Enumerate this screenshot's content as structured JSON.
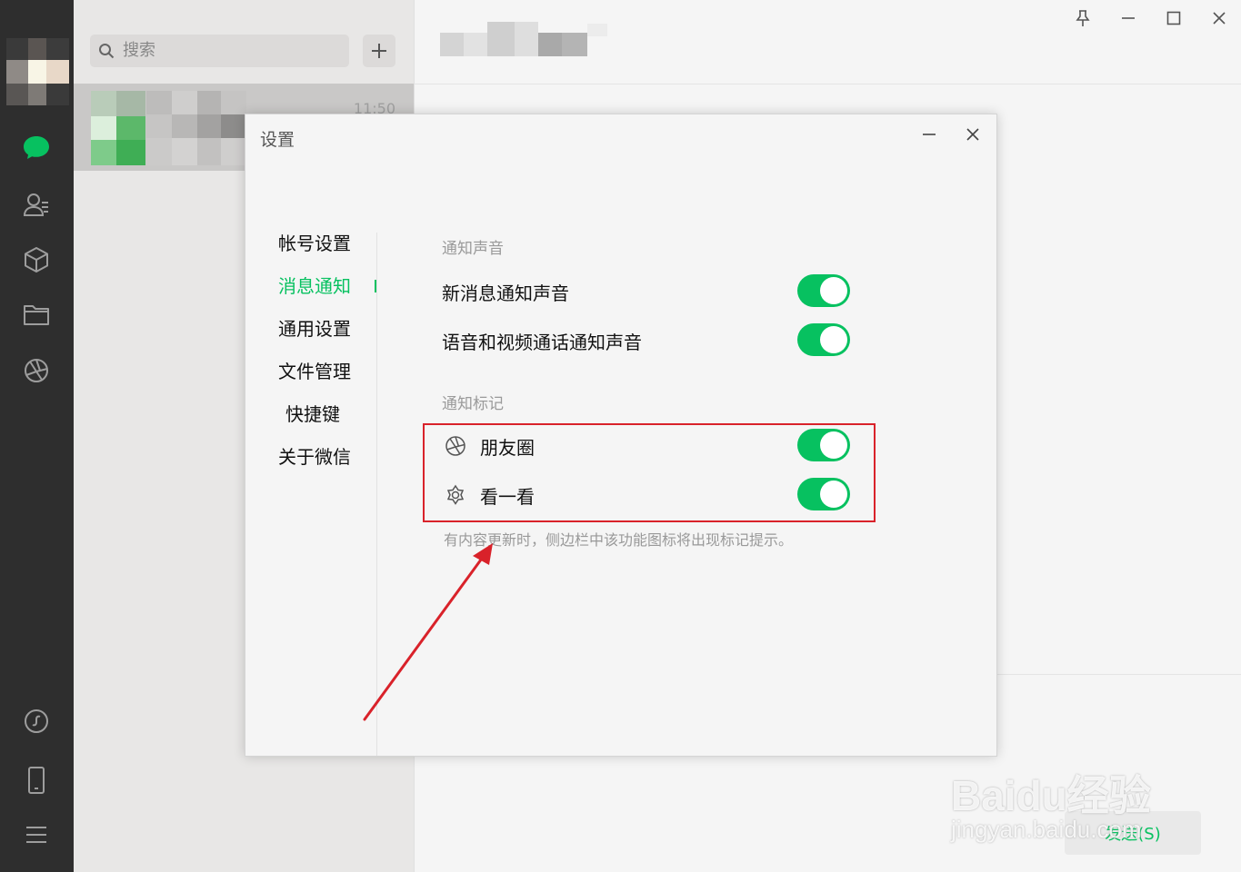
{
  "search": {
    "placeholder": "搜索"
  },
  "chat_list": {
    "items": [
      {
        "time": "11:50"
      }
    ]
  },
  "main": {
    "send_label": "发送(S)"
  },
  "settings": {
    "title": "设置",
    "nav": [
      "帐号设置",
      "消息通知",
      "通用设置",
      "文件管理",
      "快捷键",
      "关于微信"
    ],
    "active_nav": "消息通知",
    "sound_section": {
      "label": "通知声音",
      "rows": [
        {
          "label": "新消息通知声音",
          "enabled": true
        },
        {
          "label": "语音和视频通话通知声音",
          "enabled": true
        }
      ]
    },
    "badge_section": {
      "label": "通知标记",
      "rows": [
        {
          "label": "朋友圈",
          "icon": "moments-icon",
          "enabled": true
        },
        {
          "label": "看一看",
          "icon": "top-stories-icon",
          "enabled": true
        }
      ],
      "hint": "有内容更新时，侧边栏中该功能图标将出现标记提示。"
    }
  },
  "watermark": {
    "brand": "Baidu经验",
    "url": "jingyan.baidu.com"
  },
  "colors": {
    "accent": "#07c160",
    "annotation": "#d9222a",
    "rail": "#2e2e2e"
  }
}
